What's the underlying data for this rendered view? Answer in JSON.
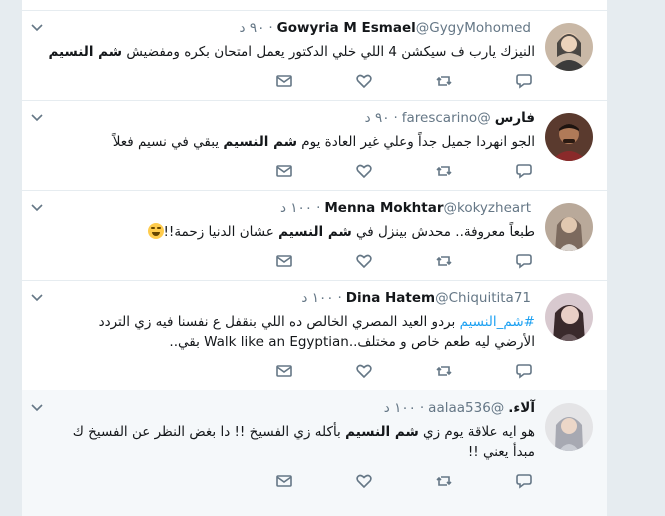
{
  "tweets": [
    {
      "fullname": "Gowyria M Esmael",
      "handle": "@GygyMohomed",
      "time": "٩٠ د",
      "text_before": "النيزك يارب ف سيكشن 4 اللي خلي الدكتور يعمل امتحان بكره ومفضيش ",
      "hashtag_bold": "شم النسيم",
      "text_after": ""
    },
    {
      "fullname": "فارس",
      "handle": "@farescarino",
      "time": "٩٠ د",
      "text_before": "الجو انهردا جميل جداً وعلي غير العادة يوم ",
      "hashtag_bold": "شم النسيم",
      "text_after": " يبقي في نسيم فعلاً"
    },
    {
      "fullname": "Menna Mokhtar",
      "handle": "@kokyzheart",
      "time": "١٠٠ د",
      "text_before": "طبعاً معروفة.. محدش بينزل في ",
      "hashtag_bold": "شم النسيم",
      "text_after": " عشان الدنيا زحمة!!"
    },
    {
      "fullname": "Dina Hatem",
      "handle": "@Chiquitita71",
      "time": "١٠٠ د",
      "hashtag_link": "#شم_النسيم",
      "text_line1": " بردو العيد المصري الخالص ده اللي بنقفل ع نفسنا فيه زي التردد",
      "text_line2": "الأرضي ليه طعم خاص و مختلف..Walk like an Egyptian بقي.."
    },
    {
      "fullname": "آلاء.",
      "handle": "@aalaa536",
      "time": "١٠٠ د",
      "text_before": "هو ايه علاقة يوم زي ",
      "hashtag_bold": "شم النسيم",
      "text_after": " بأكله زي الفسيخ !! دا بغض النظر عن الفسيخ ك",
      "text_line2": "مبدأ يعني !!"
    }
  ],
  "icons": {
    "reply": "reply-icon",
    "retweet": "retweet-icon",
    "like": "heart-icon",
    "dm": "direct-message-icon",
    "caret": "chevron-down-icon"
  },
  "colors": {
    "link": "#1da1f2",
    "muted": "#657786",
    "border": "#e6ecf0"
  }
}
